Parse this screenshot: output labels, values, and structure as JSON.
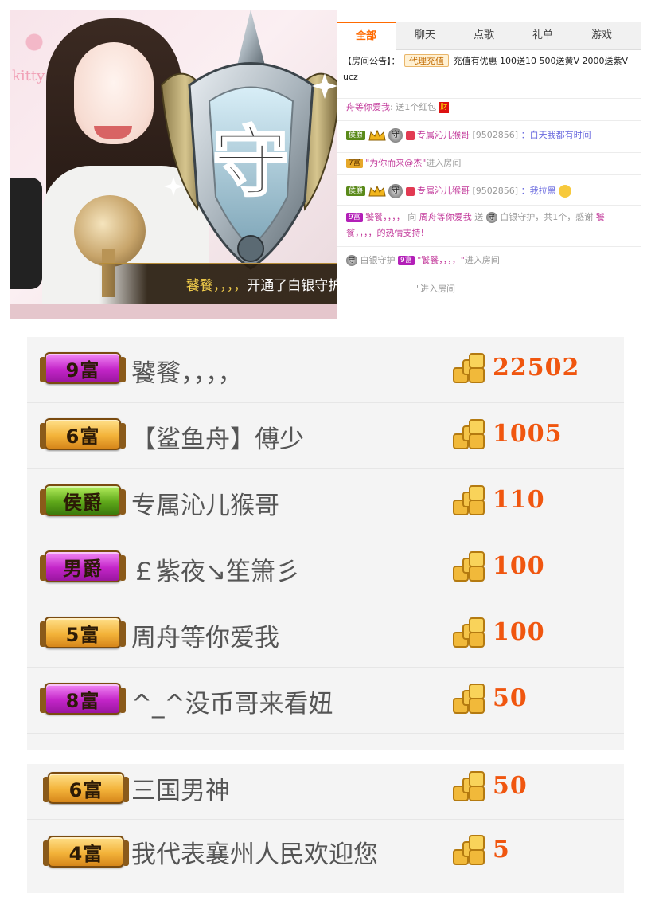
{
  "banner": {
    "name": "饕餮，，，，",
    "action": "开通了白银守护！"
  },
  "shield": {
    "glyph": "守"
  },
  "video": {
    "wall_text": "kitty"
  },
  "chat": {
    "tabs": [
      {
        "label": "全部",
        "active": true
      },
      {
        "label": "聊天",
        "active": false
      },
      {
        "label": "点歌",
        "active": false
      },
      {
        "label": "礼单",
        "active": false
      },
      {
        "label": "游戏",
        "active": false
      }
    ],
    "notice": {
      "prefix": "【房间公告】：",
      "tag": "代理充值",
      "text": "充值有优惠 100送10 500送黄V 2000送紫V",
      "tail": "ucz"
    },
    "messages": {
      "m1": {
        "user": "舟等你爱我",
        "text": ": 送1个红包",
        "icon": "财"
      },
      "m2": {
        "level": "侯爵",
        "user": "专属沁儿猴哥",
        "id": "[9502856]",
        "text": "：白天我都有时间"
      },
      "m3": {
        "level": "7富",
        "user": "\"为你而来@杰\"",
        "text": "进入房间"
      },
      "m4": {
        "level": "侯爵",
        "user": "专属沁儿猴哥",
        "id": "[9502856]",
        "text": "：我拉黑"
      },
      "m5": {
        "level": "9富",
        "user": "饕餮，，，，",
        "mid": "向",
        "target": "周舟等你爱我",
        "gift": "送",
        "giftname": "白银守护，共1个，感谢",
        "tail": "饕"
      },
      "m5b": {
        "text": "餮，，，，的热情支持!"
      },
      "m6": {
        "pre": "白银守护",
        "level": "9富",
        "user": "\"饕餮，，，，\"",
        "text": "进入房间"
      },
      "m7": {
        "text": "\"进入房间"
      }
    }
  },
  "ranking": [
    {
      "badge": "9富",
      "badge_color": "purple",
      "name": "饕餮，，，，",
      "amount": "22502"
    },
    {
      "badge": "6富",
      "badge_color": "gold",
      "name": "【鲨鱼舟】傅少",
      "amount": "1005"
    },
    {
      "badge": "侯爵",
      "badge_color": "green",
      "name": "专属沁儿猴哥",
      "amount": "110"
    },
    {
      "badge": "男爵",
      "badge_color": "purple",
      "name": "￡紫夜↘笙箫彡",
      "amount": "100"
    },
    {
      "badge": "5富",
      "badge_color": "gold",
      "name": "周舟等你爱我",
      "amount": "100"
    },
    {
      "badge": "8富",
      "badge_color": "purple",
      "name": "^_^没币哥来看妞",
      "amount": "50"
    }
  ],
  "ranking2": [
    {
      "badge": "6富",
      "badge_color": "gold",
      "name": "三国男神",
      "amount": "50"
    },
    {
      "badge": "4富",
      "badge_color": "gold",
      "name": "我代表襄州人民欢迎您",
      "amount": "5"
    }
  ]
}
